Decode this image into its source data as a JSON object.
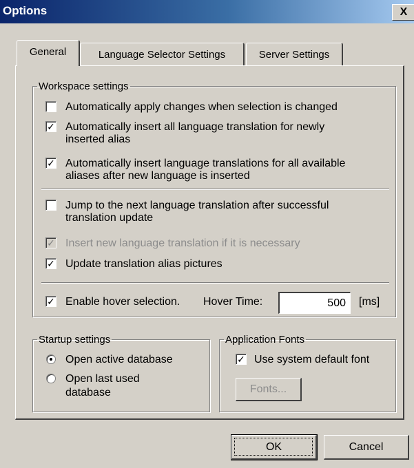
{
  "window": {
    "title": "Options",
    "close_label": "X"
  },
  "tabs": [
    {
      "label": "General",
      "active": true
    },
    {
      "label": "Language Selector Settings",
      "active": false
    },
    {
      "label": "Server Settings",
      "active": false
    }
  ],
  "workspace": {
    "legend": "Workspace settings",
    "options": [
      {
        "lines": [
          "Automatically apply changes when selection is changed"
        ],
        "checked": false,
        "enabled": true
      },
      {
        "lines": [
          "Automatically insert all language translation for newly",
          "inserted alias"
        ],
        "checked": true,
        "enabled": true
      },
      {
        "lines": [
          "Automatically insert language translations for all available",
          "aliases after new language is inserted"
        ],
        "checked": true,
        "enabled": true
      },
      {
        "lines": [
          "Jump to the next language translation after successful",
          "translation update"
        ],
        "checked": false,
        "enabled": true
      },
      {
        "lines": [
          "Insert new language translation if it is necessary"
        ],
        "checked": true,
        "enabled": false
      },
      {
        "lines": [
          "Update translation alias pictures"
        ],
        "checked": true,
        "enabled": true
      }
    ],
    "hover": {
      "label": "Enable hover selection.",
      "checked": true,
      "time_label": "Hover Time:",
      "time_value": "500",
      "unit": "[ms]"
    }
  },
  "startup": {
    "legend": "Startup settings",
    "options": [
      {
        "lines": [
          "Open active database"
        ],
        "selected": true
      },
      {
        "lines": [
          "Open last used",
          "database"
        ],
        "selected": false
      }
    ]
  },
  "fonts": {
    "legend": "Application Fonts",
    "use_default_label": "Use system default font",
    "use_default_checked": true,
    "fonts_button": "Fonts..."
  },
  "buttons": {
    "ok": "OK",
    "cancel": "Cancel"
  },
  "check_glyph": "✓"
}
